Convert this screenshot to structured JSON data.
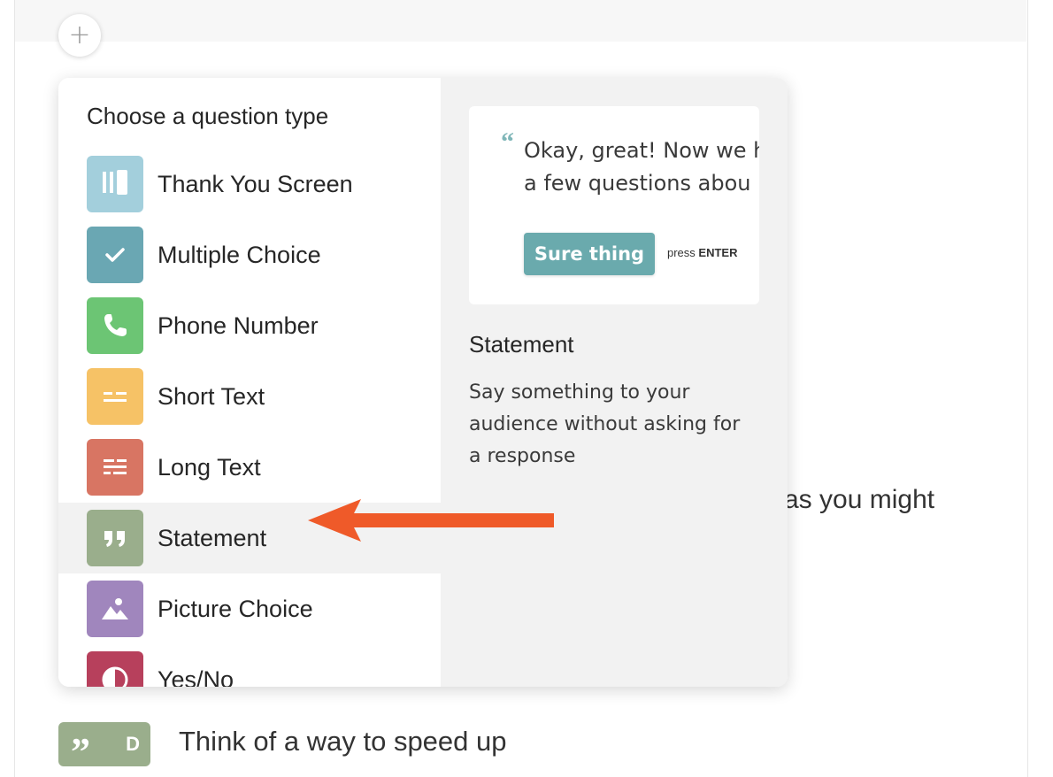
{
  "colors": {
    "thank_you": "#a3cfdc",
    "multiple_choice": "#6aa7b3",
    "phone_number": "#6cc574",
    "short_text": "#f6c266",
    "long_text": "#d87563",
    "statement": "#9aae8c",
    "picture_choice": "#a086bd",
    "yes_no": "#b7405c",
    "accent_button": "#6aaaad",
    "annotation_arrow": "#ef5a29"
  },
  "add_button": {
    "label": "+"
  },
  "background": {
    "text_1": "as you might",
    "block_badge": "D",
    "text_2": "Think of a way to speed up"
  },
  "menu": {
    "title": "Choose a question type",
    "items": [
      {
        "label": "Thank You Screen",
        "icon": "thank-you-screen-icon"
      },
      {
        "label": "Multiple Choice",
        "icon": "check-icon"
      },
      {
        "label": "Phone Number",
        "icon": "phone-icon"
      },
      {
        "label": "Short Text",
        "icon": "short-text-icon"
      },
      {
        "label": "Long Text",
        "icon": "long-text-icon"
      },
      {
        "label": "Statement",
        "icon": "quote-icon",
        "selected": true
      },
      {
        "label": "Picture Choice",
        "icon": "picture-icon"
      },
      {
        "label": "Yes/No",
        "icon": "yes-no-icon"
      }
    ]
  },
  "preview": {
    "quote_glyph": "“",
    "line_1": "Okay, great! Now we h",
    "line_2": "a few questions abou",
    "button_label": "Sure thing",
    "press_label": "press",
    "press_key": "ENTER"
  },
  "detail": {
    "title": "Statement",
    "description": "Say something to your audience without asking for a response"
  }
}
